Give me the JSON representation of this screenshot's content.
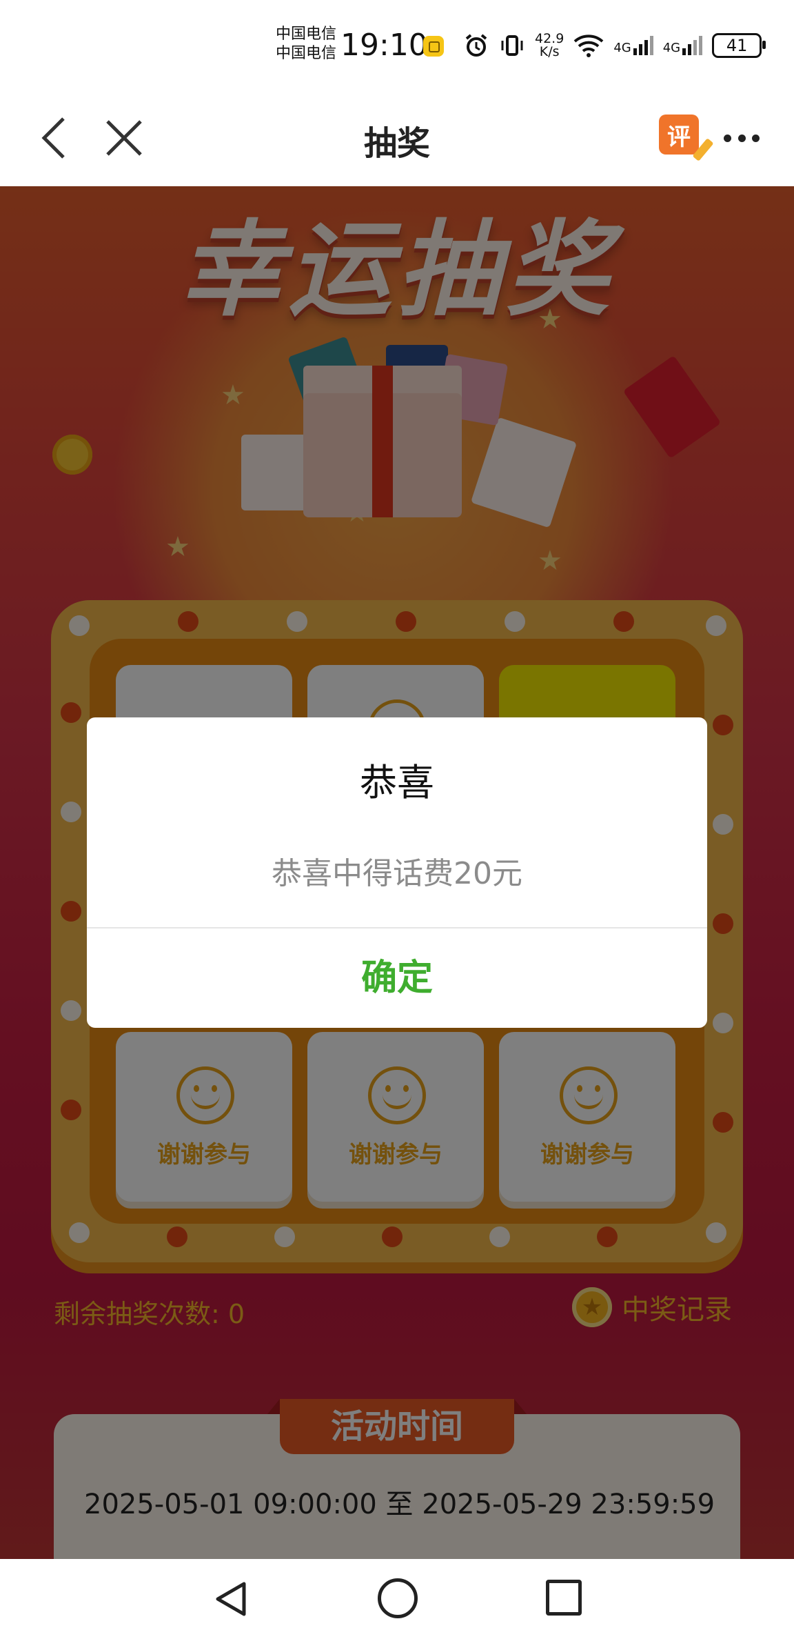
{
  "status_bar": {
    "carrier1": "中国电信",
    "carrier2": "中国电信",
    "time": "19:10",
    "speed_value": "42.9",
    "speed_unit": "K/s",
    "signal1": "4G",
    "signal2": "4G",
    "battery": "41"
  },
  "nav": {
    "title": "抽奖",
    "review_badge": "评"
  },
  "banner": {
    "title": "幸运抽奖"
  },
  "prize_grid": {
    "cells": [
      {
        "label": "谢谢参与"
      },
      {
        "label": "谢谢参与"
      },
      {
        "label": "谢谢参与"
      }
    ]
  },
  "remaining": "剩余抽奖次数: 0",
  "records_label": "中奖记录",
  "activity": {
    "heading": "活动时间",
    "range": "2025-05-01 09:00:00 至 2025-05-29 23:59:59"
  },
  "dialog": {
    "title": "恭喜",
    "message": "恭喜中得话费20元",
    "confirm": "确定"
  },
  "colors": {
    "confirm_green": "#3fad2e",
    "accent_orange": "#ea5b25",
    "highlight_yellow": "#f5eb00"
  }
}
